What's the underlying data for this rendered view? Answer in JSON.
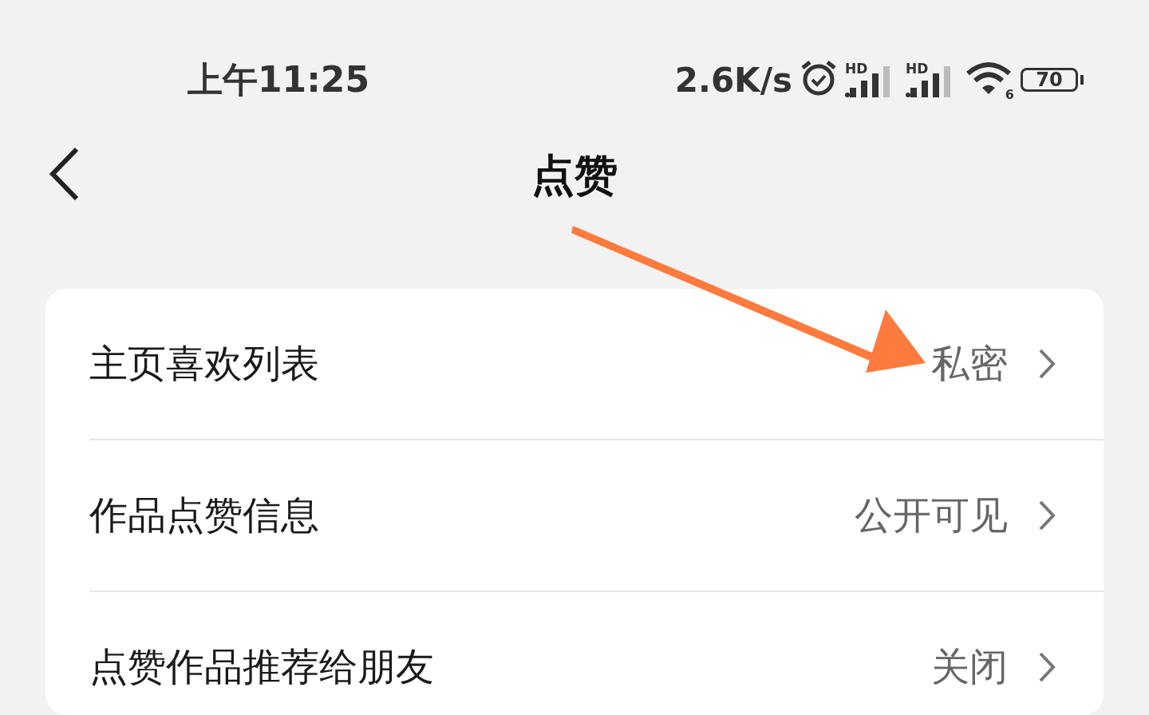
{
  "status_bar": {
    "time": "上午11:25",
    "net_speed": "2.6K/s",
    "signals": [
      {
        "label": "HD"
      },
      {
        "label": "HD"
      }
    ],
    "wifi": {
      "label": "6"
    },
    "battery": {
      "label": "70"
    }
  },
  "nav": {
    "title": "点赞"
  },
  "rows": [
    {
      "label": "主页喜欢列表",
      "value": "私密"
    },
    {
      "label": "作品点赞信息",
      "value": "公开可见"
    },
    {
      "label": "点赞作品推荐给朋友",
      "value": "关闭"
    }
  ]
}
